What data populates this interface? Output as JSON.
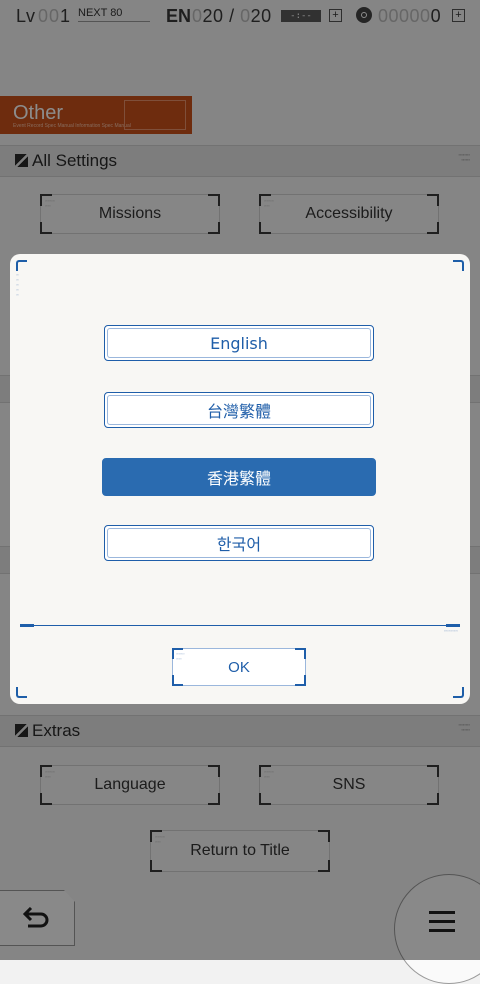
{
  "status_bar": {
    "lv_label": "Lv",
    "lv_dim": "00",
    "lv_value": "1",
    "next_label": "NEXT 80",
    "en_label": "EN",
    "en_dim_1": "0",
    "en_current": "20",
    "en_slash": "/",
    "en_dim_2": "0",
    "en_max": "20",
    "timer": "-:--",
    "coins_dim": "00000",
    "coins_value": "0"
  },
  "banner": {
    "title": "Other",
    "subtitle": "Event Record Spec Manual  Information  Spec Manual"
  },
  "sections": {
    "all_settings": "All Settings",
    "extras": "Extras"
  },
  "background_buttons": {
    "missions": "Missions",
    "accessibility": "Accessibility",
    "language": "Language",
    "sns": "SNS",
    "return_to_title": "Return to Title"
  },
  "dialog": {
    "options": [
      {
        "label": "English",
        "selected": false
      },
      {
        "label": "台灣繁體",
        "selected": false
      },
      {
        "label": "香港繁體",
        "selected": true
      },
      {
        "label": "한국어",
        "selected": false
      }
    ],
    "ok_label": "OK"
  },
  "icons": {
    "back": "back-arrow-icon",
    "menu": "hamburger-menu-icon",
    "coin": "coin-icon"
  },
  "colors": {
    "accent_blue": "#2a6bb0",
    "banner_orange": "#c9511b"
  }
}
